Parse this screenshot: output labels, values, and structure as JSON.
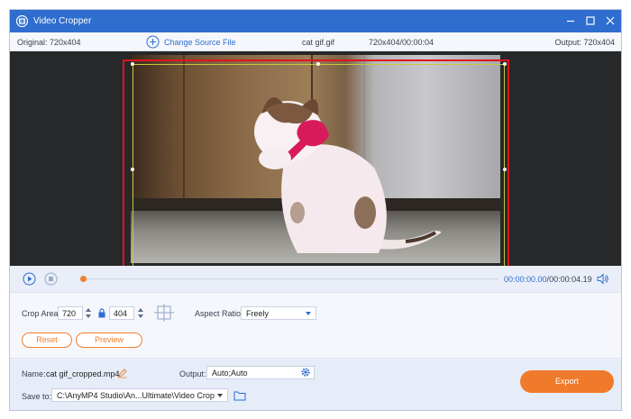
{
  "window": {
    "title": "Video Cropper"
  },
  "infobar": {
    "original": "Original: 720x404",
    "change_source": "Change Source File",
    "filename": "cat gif.gif",
    "fileinfo": "720x404/00:00:04",
    "output": "Output: 720x404"
  },
  "playback": {
    "current_time": "00:00:00.00",
    "separator": "/",
    "total_time": "00:00:04.19",
    "progress": 0.0
  },
  "crop": {
    "label": "Crop Area:",
    "width": "720",
    "height": "404",
    "aspect_label": "Aspect Ratio:",
    "aspect_value": "Freely",
    "reset": "Reset",
    "preview": "Preview"
  },
  "export": {
    "name_label": "Name:",
    "name_value": "cat gif_cropped.mp4",
    "output_label": "Output:",
    "output_value": "Auto;Auto",
    "save_label": "Save to:",
    "save_path": "C:\\AnyMP4 Studio\\An...Ultimate\\Video Crop",
    "export_button": "Export"
  },
  "colors": {
    "accent_blue": "#2f6ecf",
    "accent_orange": "#f07a2c",
    "highlight_red": "#e0141e"
  }
}
